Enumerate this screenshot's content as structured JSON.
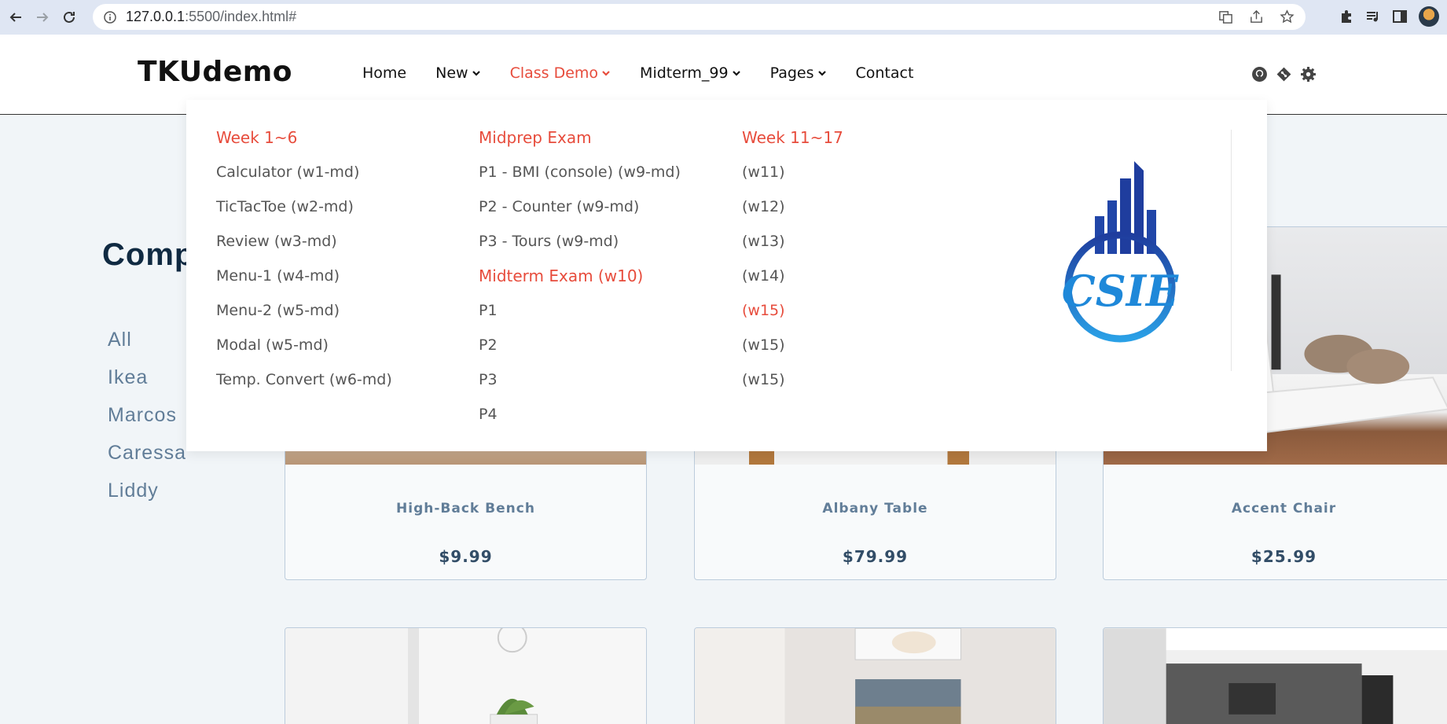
{
  "browser": {
    "url_host": "127.0.0.1",
    "url_rest": ":5500/index.html#"
  },
  "site": {
    "logo": "TKUdemo",
    "menu": [
      {
        "label": "Home",
        "dropdown": false
      },
      {
        "label": "New",
        "dropdown": true
      },
      {
        "label": "Class Demo",
        "dropdown": true
      },
      {
        "label": "Midterm_99",
        "dropdown": true
      },
      {
        "label": "Pages",
        "dropdown": true
      },
      {
        "label": "Contact",
        "dropdown": false
      }
    ],
    "social_icons": [
      "github-icon",
      "git-icon",
      "settings-gear-icon"
    ],
    "accent_color": "#e74c3c"
  },
  "mega_menu": {
    "col1": {
      "heading": "Week 1~6",
      "items": [
        "Calculator (w1-md)",
        "TicTacToe (w2-md)",
        "Review (w3-md)",
        "Menu-1 (w4-md)",
        "Menu-2 (w5-md)",
        "Modal (w5-md)",
        "Temp. Convert (w6-md)"
      ]
    },
    "col2": {
      "heading": "Midprep Exam",
      "items": [
        "P1 - BMI (console) (w9-md)",
        "P2 - Counter (w9-md)",
        "P3 - Tours (w9-md)"
      ],
      "heading2": "Midterm Exam (w10)",
      "items2": [
        "P1",
        "P2",
        "P3",
        "P4"
      ]
    },
    "col3": {
      "heading": "Week 11~17",
      "items": [
        "(w11)",
        "(w12)",
        "(w13)",
        "(w14)",
        "(w15)",
        "(w15)",
        "(w15)"
      ]
    },
    "logo_text": "CSIE"
  },
  "page": {
    "title_visible": "Comp",
    "companies": [
      "All",
      "Ikea",
      "Marcos",
      "Caressa",
      "Liddy"
    ],
    "products": [
      {
        "name": "High-Back Bench",
        "price": "$9.99"
      },
      {
        "name": "Albany Table",
        "price": "$79.99"
      },
      {
        "name": "Accent Chair",
        "price": "$25.99"
      }
    ]
  }
}
